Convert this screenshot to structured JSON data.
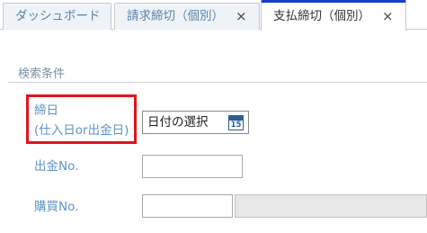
{
  "tabs": [
    {
      "label": "ダッシュボード",
      "closable": false,
      "active": false
    },
    {
      "label": "請求締切（個別）",
      "closable": true,
      "active": false
    },
    {
      "label": "支払締切（個別）",
      "closable": true,
      "active": true
    }
  ],
  "close_glyph": "×",
  "section": {
    "title": "検索条件"
  },
  "form": {
    "closing_date": {
      "label": "締日",
      "sub_label": "(仕入日or出金日)",
      "placeholder": "日付の選択",
      "calendar_day": "15",
      "icon": "calendar-icon"
    },
    "payment_no": {
      "label": "出金No.",
      "value": ""
    },
    "purchase_no": {
      "label": "購買No.",
      "value": "",
      "display_value": ""
    }
  },
  "colors": {
    "label": "#5d94c4",
    "highlight": "#e0141d",
    "active_tab_accent": "#1a3cc8",
    "inactive_tab_text": "#5a83a8"
  }
}
